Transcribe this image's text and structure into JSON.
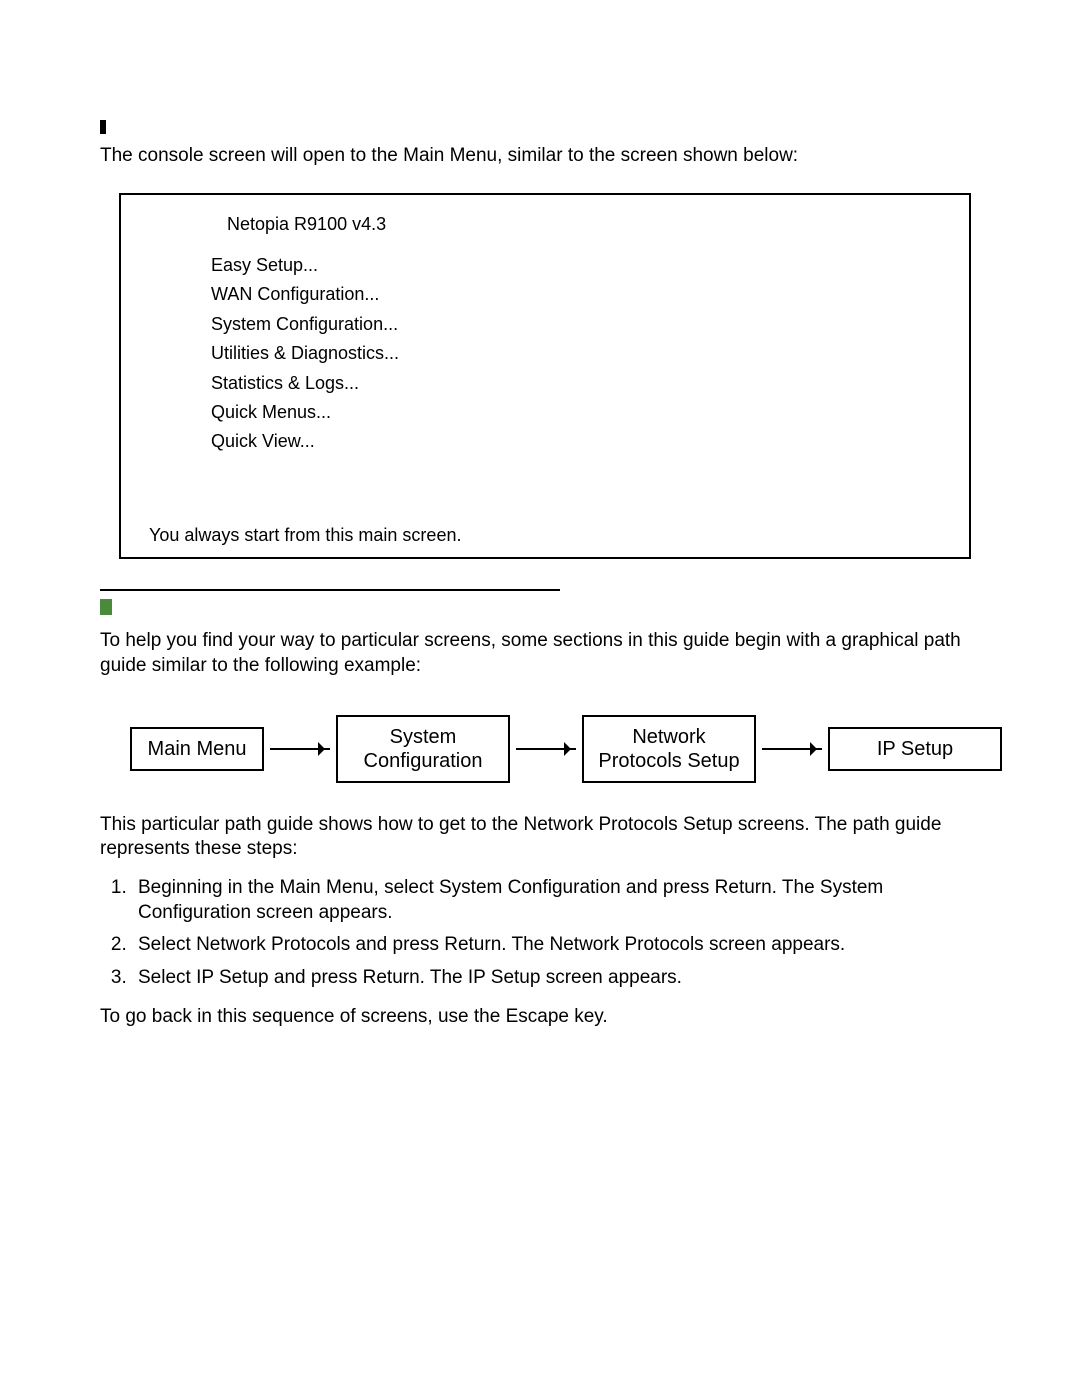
{
  "p_intro": "The console screen will open to the Main Menu, similar to the screen shown below:",
  "console": {
    "title": "Netopia R9100 v4.3",
    "items": [
      "Easy Setup...",
      "WAN Configuration...",
      "System Configuration...",
      "Utilities & Diagnostics...",
      "Statistics & Logs...",
      "Quick Menus...",
      "Quick View..."
    ],
    "footer": "You always start from this main screen."
  },
  "p_nav_intro": "To help you ﬁnd your way to particular screens, some sections in this guide begin with a graphical path guide similar to the following example:",
  "flow": {
    "b1": "Main Menu",
    "b2": "System Configuration",
    "b3": "Network Protocols Setup",
    "b4": "IP Setup"
  },
  "p_after_flow": "This particular path guide shows how to get to the Network Protocols Setup screens. The path guide represents these steps:",
  "steps": [
    "Beginning in the Main Menu, select System Conﬁguration and press Return. The System Conﬁguration screen appears.",
    "Select Network Protocols and press Return. The Network Protocols screen appears.",
    "Select IP Setup and press Return. The IP Setup screen appears."
  ],
  "p_escape": "To go back in this sequence of screens, use the Escape key."
}
